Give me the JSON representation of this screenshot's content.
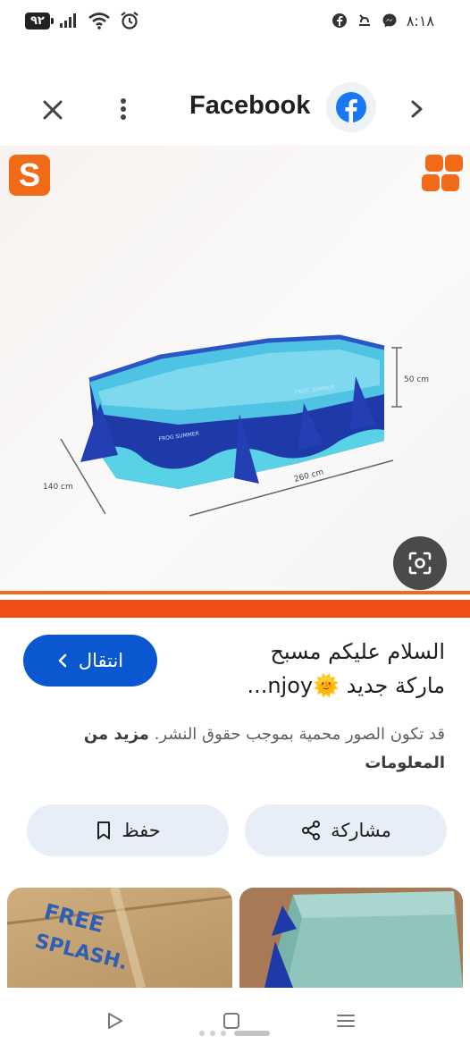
{
  "status_bar": {
    "battery": "٩٢",
    "time": "٨:١٨"
  },
  "top_bar": {
    "title": "Facebook"
  },
  "image": {
    "logo_letter": "S",
    "dim_height": "50 cm",
    "dim_width": "140 cm",
    "dim_length": "260 cm",
    "pool_text_left": "FROG SUMMER",
    "pool_text_right": "FROG SUMMER"
  },
  "details": {
    "visit_label": "انتقال",
    "title_line1": "السلام عليكم مسبح",
    "title_line2": "ماركة جديد 🌞njoy...",
    "copyright_text": "قد تكون الصور محمية بموجب حقوق النشر.",
    "more_info": "مزيد من المعلومات",
    "share_label": "مشاركة",
    "save_label": "حفظ"
  },
  "thumbnails": {
    "left_text_1": "FREE",
    "left_text_2": "SPLASH."
  },
  "colors": {
    "brand_orange": "#f06a18",
    "visit_blue": "#0b57d0",
    "facebook_blue": "#1877f2",
    "pool_blue": "#1e3aa8",
    "pool_aqua": "#5ad2e6"
  }
}
